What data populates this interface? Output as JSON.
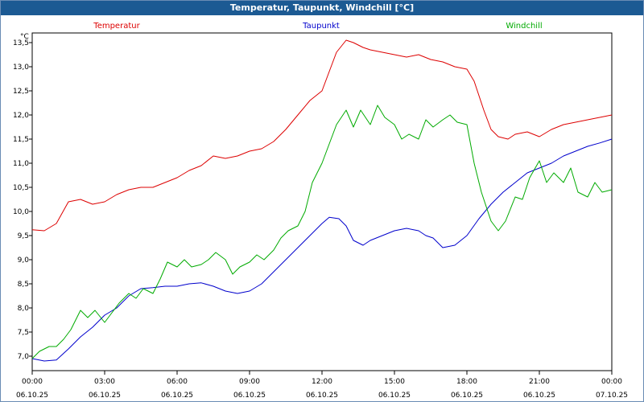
{
  "window": {
    "title": "Temperatur, Taupunkt, Windchill [°C]"
  },
  "chart_data": {
    "type": "line",
    "ylabel": "°C",
    "ylim": [
      6.7,
      13.7
    ],
    "yticks": [
      "7,0",
      "7,5",
      "8,0",
      "8,5",
      "9,0",
      "9,5",
      "10,0",
      "10,5",
      "11,0",
      "11,5",
      "12,0",
      "12,5",
      "13,0",
      "13,5"
    ],
    "xlim": [
      0,
      24
    ],
    "xticks": [
      {
        "time": "00:00",
        "date": "06.10.25"
      },
      {
        "time": "03:00",
        "date": "06.10.25"
      },
      {
        "time": "06:00",
        "date": "06.10.25"
      },
      {
        "time": "09:00",
        "date": "06.10.25"
      },
      {
        "time": "12:00",
        "date": "06.10.25"
      },
      {
        "time": "15:00",
        "date": "06.10.25"
      },
      {
        "time": "18:00",
        "date": "06.10.25"
      },
      {
        "time": "21:00",
        "date": "06.10.25"
      },
      {
        "time": "00:00",
        "date": "07.10.25"
      }
    ],
    "grid": true,
    "series": [
      {
        "name": "Temperatur",
        "color": "#dd0000",
        "points": [
          [
            0,
            9.62
          ],
          [
            0.5,
            9.6
          ],
          [
            1,
            9.75
          ],
          [
            1.5,
            10.2
          ],
          [
            2,
            10.25
          ],
          [
            2.5,
            10.15
          ],
          [
            3,
            10.2
          ],
          [
            3.5,
            10.35
          ],
          [
            4,
            10.45
          ],
          [
            4.5,
            10.5
          ],
          [
            5,
            10.5
          ],
          [
            5.5,
            10.6
          ],
          [
            6,
            10.7
          ],
          [
            6.5,
            10.85
          ],
          [
            7,
            10.95
          ],
          [
            7.5,
            11.15
          ],
          [
            8,
            11.1
          ],
          [
            8.5,
            11.15
          ],
          [
            9,
            11.25
          ],
          [
            9.5,
            11.3
          ],
          [
            10,
            11.45
          ],
          [
            10.5,
            11.7
          ],
          [
            11,
            12.0
          ],
          [
            11.5,
            12.3
          ],
          [
            12,
            12.5
          ],
          [
            12.3,
            12.9
          ],
          [
            12.6,
            13.3
          ],
          [
            13,
            13.55
          ],
          [
            13.3,
            13.5
          ],
          [
            13.7,
            13.4
          ],
          [
            14,
            13.35
          ],
          [
            14.5,
            13.3
          ],
          [
            15,
            13.25
          ],
          [
            15.5,
            13.2
          ],
          [
            16,
            13.25
          ],
          [
            16.5,
            13.15
          ],
          [
            17,
            13.1
          ],
          [
            17.5,
            13.0
          ],
          [
            18,
            12.95
          ],
          [
            18.3,
            12.7
          ],
          [
            18.7,
            12.1
          ],
          [
            19,
            11.7
          ],
          [
            19.3,
            11.55
          ],
          [
            19.7,
            11.5
          ],
          [
            20,
            11.6
          ],
          [
            20.5,
            11.65
          ],
          [
            21,
            11.55
          ],
          [
            21.5,
            11.7
          ],
          [
            22,
            11.8
          ],
          [
            22.5,
            11.85
          ],
          [
            23,
            11.9
          ],
          [
            23.5,
            11.95
          ],
          [
            24,
            12.0
          ]
        ]
      },
      {
        "name": "Taupunkt",
        "color": "#0000cc",
        "points": [
          [
            0,
            6.95
          ],
          [
            0.5,
            6.9
          ],
          [
            1,
            6.92
          ],
          [
            1.5,
            7.15
          ],
          [
            2,
            7.4
          ],
          [
            2.5,
            7.6
          ],
          [
            3,
            7.85
          ],
          [
            3.5,
            8.0
          ],
          [
            4,
            8.25
          ],
          [
            4.5,
            8.4
          ],
          [
            5,
            8.42
          ],
          [
            5.5,
            8.45
          ],
          [
            6,
            8.45
          ],
          [
            6.5,
            8.5
          ],
          [
            7,
            8.52
          ],
          [
            7.5,
            8.45
          ],
          [
            8,
            8.35
          ],
          [
            8.5,
            8.3
          ],
          [
            9,
            8.35
          ],
          [
            9.5,
            8.5
          ],
          [
            10,
            8.75
          ],
          [
            10.5,
            9.0
          ],
          [
            11,
            9.25
          ],
          [
            11.5,
            9.5
          ],
          [
            12,
            9.75
          ],
          [
            12.3,
            9.88
          ],
          [
            12.7,
            9.85
          ],
          [
            13,
            9.7
          ],
          [
            13.3,
            9.4
          ],
          [
            13.7,
            9.3
          ],
          [
            14,
            9.4
          ],
          [
            14.5,
            9.5
          ],
          [
            15,
            9.6
          ],
          [
            15.5,
            9.65
          ],
          [
            16,
            9.6
          ],
          [
            16.3,
            9.5
          ],
          [
            16.6,
            9.45
          ],
          [
            17,
            9.25
          ],
          [
            17.5,
            9.3
          ],
          [
            18,
            9.5
          ],
          [
            18.5,
            9.85
          ],
          [
            19,
            10.15
          ],
          [
            19.5,
            10.4
          ],
          [
            20,
            10.6
          ],
          [
            20.5,
            10.8
          ],
          [
            21,
            10.9
          ],
          [
            21.5,
            11.0
          ],
          [
            22,
            11.15
          ],
          [
            22.5,
            11.25
          ],
          [
            23,
            11.35
          ],
          [
            23.5,
            11.42
          ],
          [
            24,
            11.5
          ]
        ]
      },
      {
        "name": "Windchill",
        "color": "#00aa00",
        "points": [
          [
            0,
            6.95
          ],
          [
            0.3,
            7.1
          ],
          [
            0.7,
            7.2
          ],
          [
            1,
            7.2
          ],
          [
            1.3,
            7.35
          ],
          [
            1.6,
            7.55
          ],
          [
            2,
            7.95
          ],
          [
            2.3,
            7.8
          ],
          [
            2.6,
            7.95
          ],
          [
            3,
            7.7
          ],
          [
            3.3,
            7.9
          ],
          [
            3.6,
            8.1
          ],
          [
            4,
            8.3
          ],
          [
            4.3,
            8.2
          ],
          [
            4.6,
            8.4
          ],
          [
            5,
            8.3
          ],
          [
            5.3,
            8.6
          ],
          [
            5.6,
            8.95
          ],
          [
            6,
            8.85
          ],
          [
            6.3,
            9.0
          ],
          [
            6.6,
            8.85
          ],
          [
            7,
            8.9
          ],
          [
            7.3,
            9.0
          ],
          [
            7.6,
            9.15
          ],
          [
            8,
            9.0
          ],
          [
            8.3,
            8.7
          ],
          [
            8.6,
            8.85
          ],
          [
            9,
            8.95
          ],
          [
            9.3,
            9.1
          ],
          [
            9.6,
            9.0
          ],
          [
            10,
            9.2
          ],
          [
            10.3,
            9.45
          ],
          [
            10.6,
            9.6
          ],
          [
            11,
            9.7
          ],
          [
            11.3,
            10.0
          ],
          [
            11.6,
            10.6
          ],
          [
            12,
            11.0
          ],
          [
            12.3,
            11.4
          ],
          [
            12.6,
            11.8
          ],
          [
            13,
            12.1
          ],
          [
            13.3,
            11.75
          ],
          [
            13.6,
            12.1
          ],
          [
            14,
            11.8
          ],
          [
            14.3,
            12.2
          ],
          [
            14.6,
            11.95
          ],
          [
            15,
            11.8
          ],
          [
            15.3,
            11.5
          ],
          [
            15.6,
            11.6
          ],
          [
            16,
            11.5
          ],
          [
            16.3,
            11.9
          ],
          [
            16.6,
            11.75
          ],
          [
            17,
            11.9
          ],
          [
            17.3,
            12.0
          ],
          [
            17.6,
            11.85
          ],
          [
            18,
            11.8
          ],
          [
            18.3,
            11.0
          ],
          [
            18.6,
            10.4
          ],
          [
            19,
            9.8
          ],
          [
            19.3,
            9.6
          ],
          [
            19.6,
            9.8
          ],
          [
            20,
            10.3
          ],
          [
            20.3,
            10.25
          ],
          [
            20.6,
            10.7
          ],
          [
            21,
            11.05
          ],
          [
            21.3,
            10.6
          ],
          [
            21.6,
            10.8
          ],
          [
            22,
            10.6
          ],
          [
            22.3,
            10.9
          ],
          [
            22.6,
            10.4
          ],
          [
            23,
            10.3
          ],
          [
            23.3,
            10.6
          ],
          [
            23.6,
            10.4
          ],
          [
            24,
            10.45
          ]
        ]
      }
    ]
  }
}
